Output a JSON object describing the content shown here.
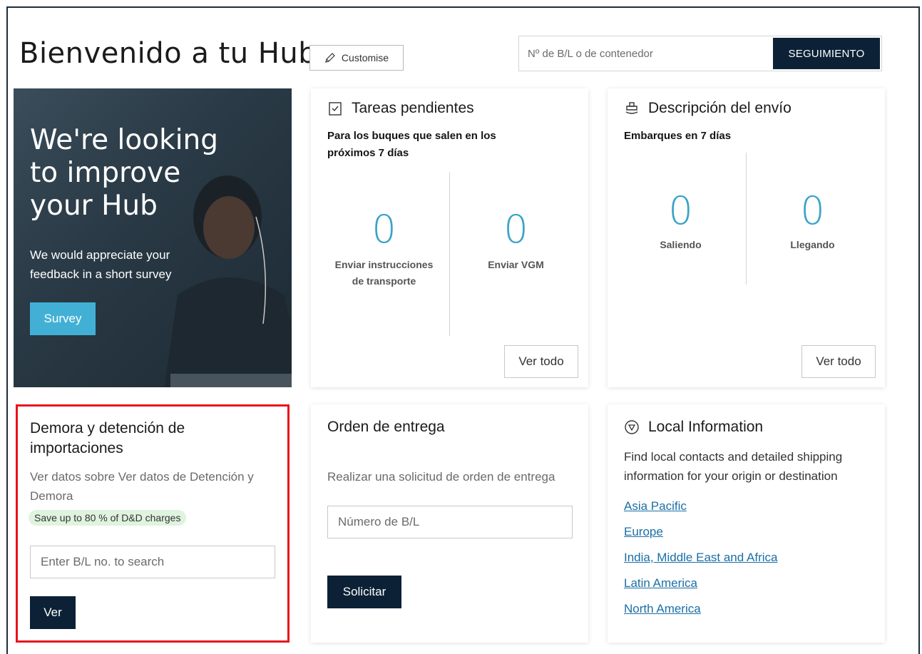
{
  "header": {
    "title": "Bienvenido a tu Hub",
    "customise_label": "Customise",
    "search_placeholder": "Nº de B/L o de contenedor",
    "search_button": "SEGUIMIENTO"
  },
  "hero": {
    "heading": "We're looking to improve your Hub",
    "text": "We would appreciate your feedback in a short survey",
    "button": "Survey"
  },
  "tasks": {
    "title": "Tareas pendientes",
    "subtitle": "Para los buques que salen en los próximos 7 días",
    "stats": [
      {
        "value": "0",
        "label": "Enviar instrucciones de transporte"
      },
      {
        "value": "0",
        "label": "Enviar VGM"
      }
    ],
    "button": "Ver todo"
  },
  "shipment": {
    "title": "Descripción del envío",
    "subtitle": "Embarques en 7 días",
    "stats": [
      {
        "value": "0",
        "label": "Saliendo"
      },
      {
        "value": "0",
        "label": "Llegando"
      }
    ],
    "button": "Ver todo"
  },
  "demurrage": {
    "title": "Demora y detención de importaciones",
    "description": "Ver datos sobre Ver datos de Detención y Demora",
    "badge": "Save up to 80 % of D&D charges",
    "input_placeholder": "Enter B/L no. to search",
    "button": "Ver"
  },
  "delivery": {
    "title": "Orden de entrega",
    "description": "Realizar una solicitud de orden de entrega",
    "input_placeholder": "Número de B/L",
    "button": "Solicitar"
  },
  "local": {
    "title": "Local Information",
    "description": "Find local contacts and detailed shipping information for your origin or destination",
    "links": [
      "Asia Pacific",
      "Europe",
      "India, Middle East and Africa",
      "Latin America",
      "North America"
    ]
  },
  "colors": {
    "primary_dark": "#0c2136",
    "accent": "#3aa3c8",
    "survey": "#42b0d5",
    "highlight": "#e8131b",
    "badge_bg": "#dff3df",
    "link": "#1b6fa6"
  }
}
